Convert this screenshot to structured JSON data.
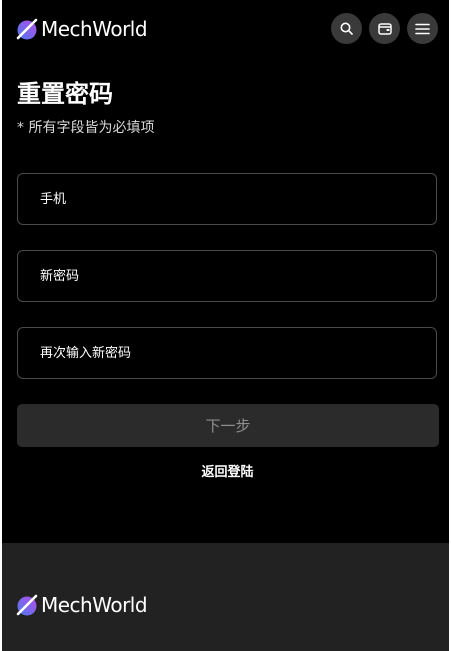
{
  "header": {
    "brand": "MechWorld",
    "icons": {
      "logo": "mechworld-logo-mark",
      "search": "search-icon",
      "wallet": "wallet-icon",
      "menu": "hamburger-menu-icon"
    }
  },
  "main": {
    "title": "重置密码",
    "subtitle": "* 所有字段皆为必填项",
    "fields": {
      "phone_placeholder": "手机",
      "new_password_placeholder": "新密码",
      "confirm_password_placeholder": "再次输入新密码"
    },
    "next_label": "下一步",
    "back_label": "返回登陆"
  },
  "footer": {
    "brand": "MechWorld"
  },
  "colors": {
    "background": "#000000",
    "footer_bg": "#222222",
    "icon_button_bg": "#3a3a3a",
    "field_border": "#4a4a4a",
    "button_bg": "#2b2b2b",
    "button_text": "#8e8e8e",
    "logo_gradient_start": "#4a7cf0",
    "logo_gradient_end": "#b64ce8"
  }
}
